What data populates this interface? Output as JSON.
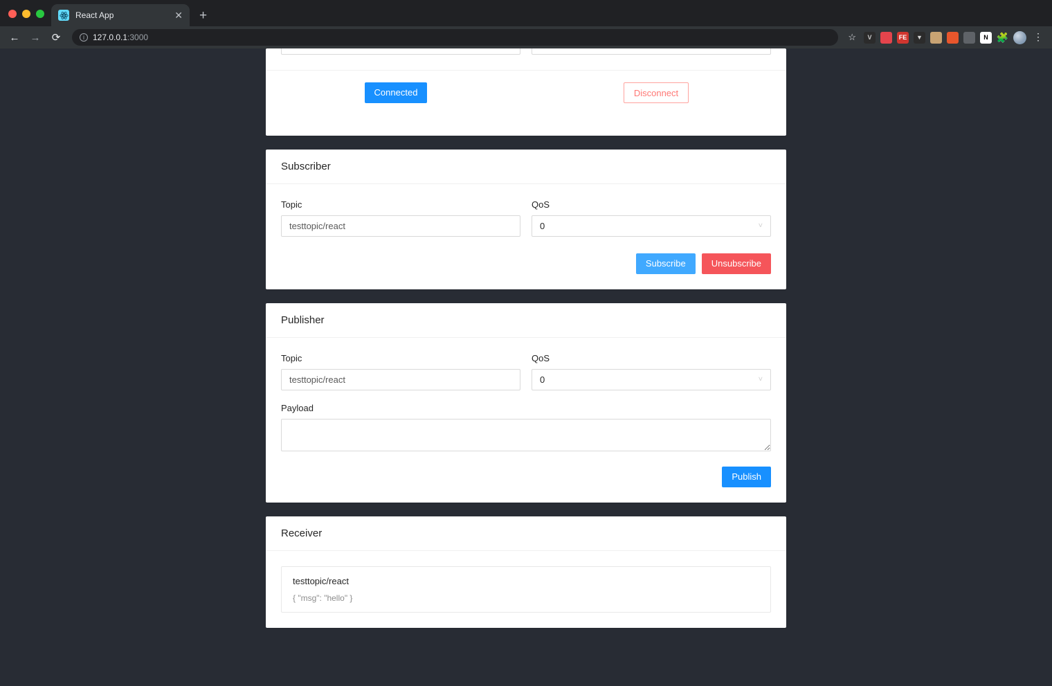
{
  "browser": {
    "tab": {
      "title": "React App",
      "favicon_icon": "react-atom-icon",
      "close_icon": "close-icon"
    },
    "new_tab_icon": "plus-icon",
    "nav": {
      "back_icon": "arrow-left-icon",
      "forward_icon": "arrow-right-icon",
      "reload_icon": "reload-icon"
    },
    "omnibox": {
      "info_icon": "info-circle-icon",
      "url_host": "127.0.0.1",
      "url_port": ":3000"
    },
    "star_icon": "star-icon",
    "extensions": [
      {
        "name": "vimium-extension-icon",
        "glyph": "V",
        "color": "#2b2b2b",
        "text_color": "#c8c8c8"
      },
      {
        "name": "redux-devtools-extension-icon",
        "glyph": "",
        "color": "#e4444c",
        "text_color": "#ffffff"
      },
      {
        "name": "feedly-extension-icon",
        "glyph": "FE",
        "color": "#d0362f",
        "text_color": "#ffffff"
      },
      {
        "name": "pocket-extension-icon",
        "glyph": "",
        "color": "#2b2b2b",
        "text_color": "#d5d5d5"
      },
      {
        "name": "character-avatar-extension-icon",
        "glyph": "",
        "color": "#c8a373",
        "text_color": "#ffffff"
      },
      {
        "name": "bitwarden-extension-icon",
        "glyph": "",
        "color": "#e8562c",
        "text_color": "#ffffff"
      },
      {
        "name": "image-extension-icon",
        "glyph": "",
        "color": "#5f6368",
        "text_color": "#d5d5d5"
      },
      {
        "name": "notion-extension-icon",
        "glyph": "N",
        "color": "#ffffff",
        "text_color": "#000000"
      },
      {
        "name": "puzzle-extensions-icon",
        "glyph": "",
        "color": "#323639",
        "text_color": "#e8eaed"
      }
    ],
    "profile_avatar_icon": "profile-avatar-icon",
    "menu_icon": "kebab-menu-icon"
  },
  "connection": {
    "field_left_value": "",
    "field_left_placeholder": "",
    "field_right_value": "",
    "field_right_placeholder": "",
    "connected_label": "Connected",
    "disconnect_label": "Disconnect"
  },
  "subscriber": {
    "title": "Subscriber",
    "topic_label": "Topic",
    "topic_value": "testtopic/react",
    "qos_label": "QoS",
    "qos_value": "0",
    "qos_chevron_icon": "chevron-down-icon",
    "subscribe_label": "Subscribe",
    "unsubscribe_label": "Unsubscribe"
  },
  "publisher": {
    "title": "Publisher",
    "topic_label": "Topic",
    "topic_value": "testtopic/react",
    "qos_label": "QoS",
    "qos_value": "0",
    "qos_chevron_icon": "chevron-down-icon",
    "payload_label": "Payload",
    "payload_value": "",
    "payload_placeholder": "",
    "publish_label": "Publish"
  },
  "receiver": {
    "title": "Receiver",
    "messages": [
      {
        "topic": "testtopic/react",
        "body": "{ \"msg\": \"hello\" }"
      }
    ]
  },
  "colors": {
    "page_background": "#282c34",
    "primary_blue": "#1890ff",
    "light_blue": "#40a9ff",
    "danger_red": "#f5555a",
    "danger_outline": "#ff7875"
  }
}
